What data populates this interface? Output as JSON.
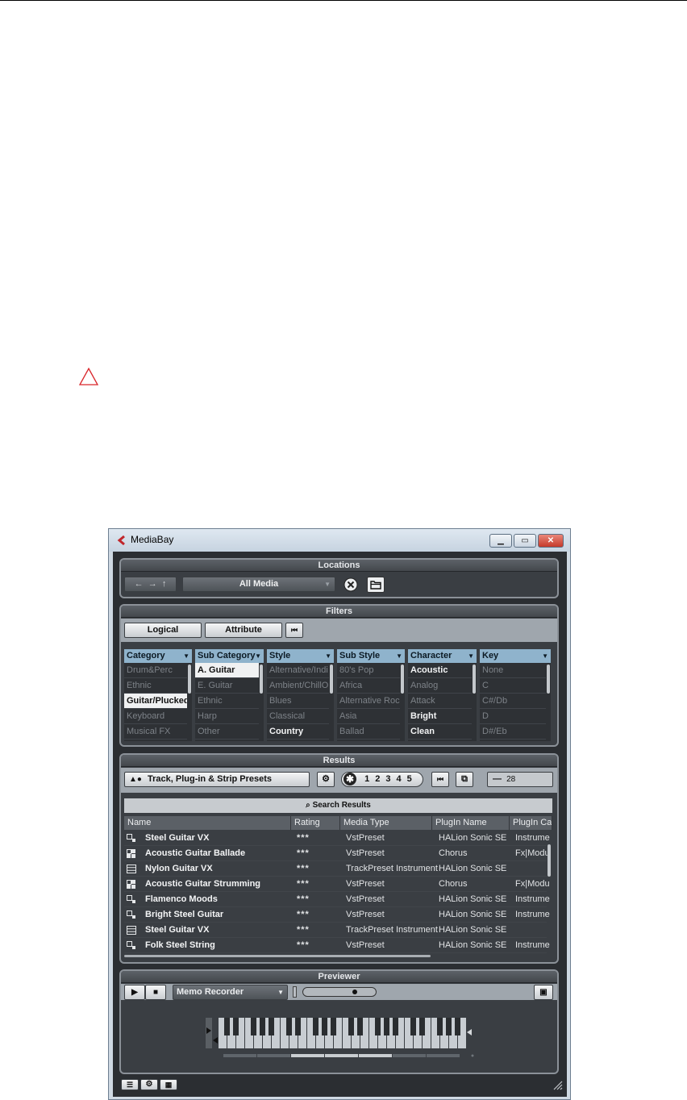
{
  "window": {
    "title": "MediaBay"
  },
  "locations": {
    "title": "Locations",
    "dropdown_value": "All Media"
  },
  "filters": {
    "title": "Filters",
    "logical_label": "Logical",
    "attribute_label": "Attribute",
    "columns": [
      {
        "header": "Category",
        "items": [
          {
            "text": "Drum&Perc",
            "state": "dim"
          },
          {
            "text": "Ethnic",
            "state": "dim"
          },
          {
            "text": "Guitar/Plucked",
            "state": "sel"
          },
          {
            "text": "Keyboard",
            "state": "dim"
          },
          {
            "text": "Musical FX",
            "state": "dim"
          }
        ]
      },
      {
        "header": "Sub Category",
        "items": [
          {
            "text": "A. Guitar",
            "state": "sel"
          },
          {
            "text": "E. Guitar",
            "state": "dim"
          },
          {
            "text": "Ethnic",
            "state": "dim"
          },
          {
            "text": "Harp",
            "state": "dim"
          },
          {
            "text": "Other",
            "state": "dim"
          }
        ]
      },
      {
        "header": "Style",
        "items": [
          {
            "text": "Alternative/Indi",
            "state": "dim"
          },
          {
            "text": "Ambient/ChillO",
            "state": "dim"
          },
          {
            "text": "Blues",
            "state": "dim"
          },
          {
            "text": "Classical",
            "state": "dim"
          },
          {
            "text": "Country",
            "state": "b"
          }
        ]
      },
      {
        "header": "Sub Style",
        "items": [
          {
            "text": "80's Pop",
            "state": "dim"
          },
          {
            "text": "Africa",
            "state": "dim"
          },
          {
            "text": "Alternative Rock",
            "state": "dim"
          },
          {
            "text": "Asia",
            "state": "dim"
          },
          {
            "text": "Ballad",
            "state": "dim"
          }
        ]
      },
      {
        "header": "Character",
        "items": [
          {
            "text": "Acoustic",
            "state": "b"
          },
          {
            "text": "Analog",
            "state": "dim"
          },
          {
            "text": "Attack",
            "state": "dim"
          },
          {
            "text": "Bright",
            "state": "b"
          },
          {
            "text": "Clean",
            "state": "b"
          }
        ]
      },
      {
        "header": "Key",
        "items": [
          {
            "text": "None",
            "state": "dim"
          },
          {
            "text": "C",
            "state": "dim"
          },
          {
            "text": "C#/Db",
            "state": "dim"
          },
          {
            "text": "D",
            "state": "dim"
          },
          {
            "text": "D#/Eb",
            "state": "dim"
          }
        ]
      }
    ]
  },
  "results": {
    "title": "Results",
    "preset_type": "Track, Plug-in & Strip Presets",
    "rating_digits": [
      "1",
      "2",
      "3",
      "4",
      "5"
    ],
    "count_prefix": "—",
    "count": "28",
    "search_label": "Search Results",
    "headers": [
      "Name",
      "Rating",
      "Media Type",
      "PlugIn Name",
      "PlugIn Ca"
    ],
    "rows": [
      {
        "icon": "instrument-preset-icon",
        "name": "Steel Guitar VX",
        "rating": "***",
        "type": "VstPreset",
        "plugin": "HALion Sonic SE",
        "cat": "Instrume"
      },
      {
        "icon": "fx-preset-icon",
        "name": "Acoustic Guitar Ballade",
        "rating": "***",
        "type": "VstPreset",
        "plugin": "Chorus",
        "cat": "Fx|Modu"
      },
      {
        "icon": "track-preset-icon",
        "name": "Nylon Guitar VX",
        "rating": "***",
        "type": "TrackPreset Instrument",
        "plugin": "HALion Sonic SE",
        "cat": ""
      },
      {
        "icon": "fx-preset-icon",
        "name": "Acoustic Guitar Strumming",
        "rating": "***",
        "type": "VstPreset",
        "plugin": "Chorus",
        "cat": "Fx|Modu"
      },
      {
        "icon": "instrument-preset-icon",
        "name": "Flamenco Moods",
        "rating": "***",
        "type": "VstPreset",
        "plugin": "HALion Sonic SE",
        "cat": "Instrume"
      },
      {
        "icon": "instrument-preset-icon",
        "name": "Bright Steel Guitar",
        "rating": "***",
        "type": "VstPreset",
        "plugin": "HALion Sonic SE",
        "cat": "Instrume"
      },
      {
        "icon": "track-preset-icon",
        "name": "Steel Guitar VX",
        "rating": "***",
        "type": "TrackPreset Instrument",
        "plugin": "HALion Sonic SE",
        "cat": ""
      },
      {
        "icon": "instrument-preset-icon",
        "name": "Folk Steel String",
        "rating": "***",
        "type": "VstPreset",
        "plugin": "HALion Sonic SE",
        "cat": "Instrume"
      }
    ]
  },
  "previewer": {
    "title": "Previewer",
    "recorder_value": "Memo Recorder"
  },
  "colors": {
    "panel_bg": "#3a3e43",
    "filter_header": "#8fb3cc",
    "warning_red": "#d9262b"
  }
}
